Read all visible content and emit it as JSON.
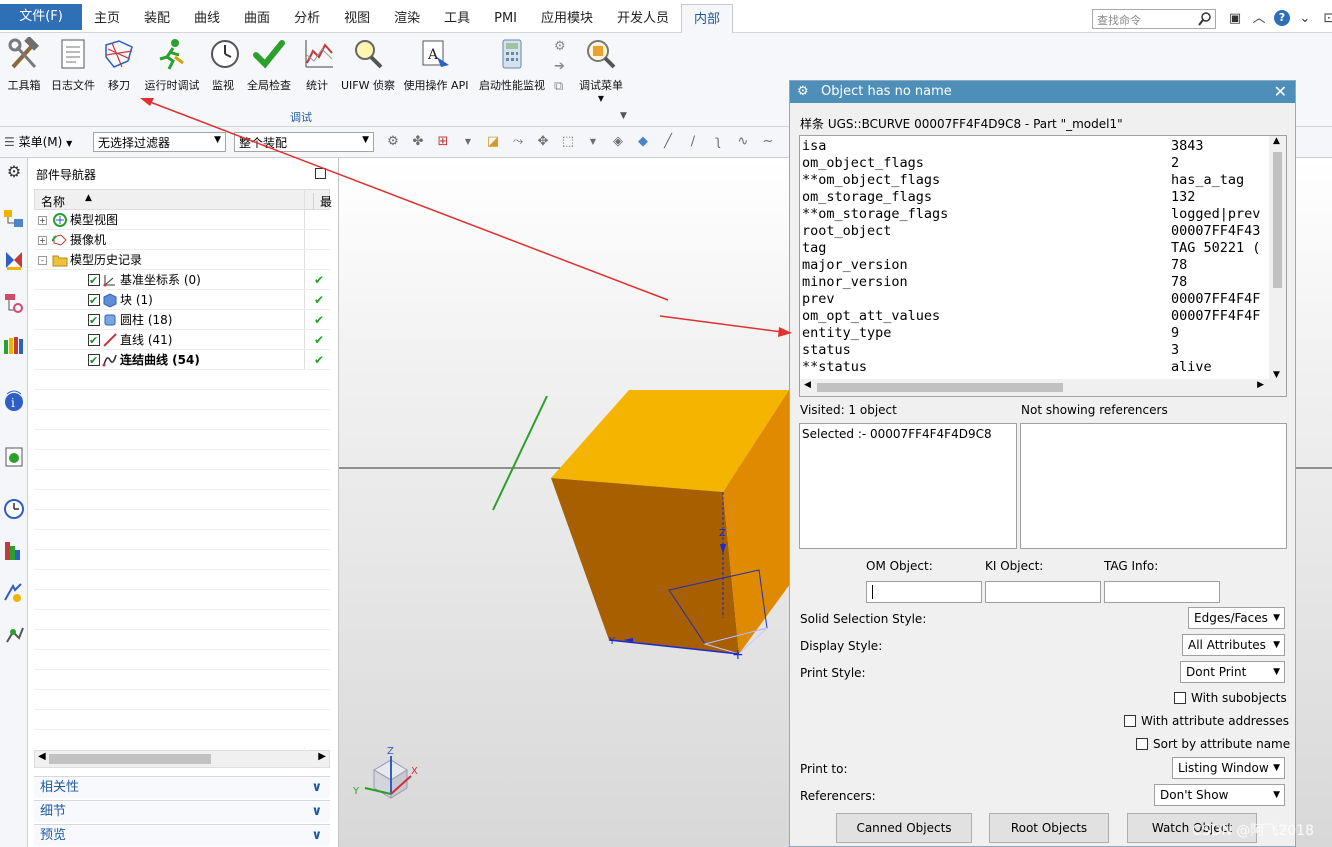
{
  "menubar": {
    "file_menu": "文件(F)",
    "tabs": [
      "主页",
      "装配",
      "曲线",
      "曲面",
      "分析",
      "视图",
      "渲染",
      "工具",
      "PMI",
      "应用模块",
      "开发人员",
      "内部"
    ],
    "active_tab": "内部",
    "search_placeholder": "查找命令"
  },
  "ribbon": {
    "buttons": [
      {
        "label": "工具箱",
        "icon": "hammer-wrench-icon"
      },
      {
        "label": "日志文件",
        "icon": "document-icon"
      },
      {
        "label": "移刀",
        "icon": "tool-path-icon"
      },
      {
        "label": "运行时调试",
        "icon": "runner-icon"
      },
      {
        "label": "监视",
        "icon": "clock-icon"
      },
      {
        "label": "全局检查",
        "icon": "checkmark-icon"
      },
      {
        "label": "统计",
        "icon": "chart-icon"
      },
      {
        "label": "UIFW 侦察",
        "icon": "magnifier-icon"
      },
      {
        "label": "使用操作 API",
        "icon": "api-icon"
      },
      {
        "label": "启动性能监视",
        "icon": "calculator-icon"
      },
      {
        "label": "调试菜单",
        "icon": "debug-menu-icon"
      }
    ],
    "group_label": "调试"
  },
  "selection_bar": {
    "menu_label": "菜单(M)",
    "filter": "无选择过滤器",
    "scope": "整个装配"
  },
  "navigator": {
    "title": "部件导航器",
    "col_name": "名称",
    "col_latest": "最",
    "rows": [
      {
        "label": "模型视图",
        "level": 0,
        "expander": "+",
        "checked": false,
        "ok": false,
        "icon": "model-views-icon"
      },
      {
        "label": "摄像机",
        "level": 0,
        "expander": "+",
        "checked": false,
        "ok": false,
        "icon": "camera-icon"
      },
      {
        "label": "模型历史记录",
        "level": 0,
        "expander": "-",
        "checked": false,
        "ok": false,
        "icon": "folder-icon"
      },
      {
        "label": "基准坐标系 (0)",
        "level": 1,
        "expander": "",
        "checked": true,
        "ok": true,
        "icon": "datum-csys-icon"
      },
      {
        "label": "块 (1)",
        "level": 1,
        "expander": "",
        "checked": true,
        "ok": true,
        "icon": "block-icon"
      },
      {
        "label": "圆柱 (18)",
        "level": 1,
        "expander": "",
        "checked": true,
        "ok": true,
        "icon": "cylinder-icon"
      },
      {
        "label": "直线 (41)",
        "level": 1,
        "expander": "",
        "checked": true,
        "ok": true,
        "icon": "line-icon"
      },
      {
        "label": "连结曲线 (54)",
        "level": 1,
        "expander": "",
        "checked": true,
        "ok": true,
        "icon": "joined-curve-icon",
        "bold": true
      }
    ],
    "ok_mark": "✔",
    "sections": [
      "相关性",
      "细节",
      "预览"
    ]
  },
  "triad": {
    "x": "X",
    "y": "Y",
    "z": "Z"
  },
  "model_labels": {
    "z": "Z",
    "y": "Y"
  },
  "dialog": {
    "title": "Object has no name",
    "info": "样条 UGS::BCURVE 00007FF4F4D9C8 - Part \"_model1\"",
    "attributes": [
      {
        "key": "isa",
        "value": "3843"
      },
      {
        "key": "om_object_flags",
        "value": "2"
      },
      {
        "key": "**om_object_flags",
        "value": "has_a_tag"
      },
      {
        "key": "om_storage_flags",
        "value": "132"
      },
      {
        "key": "**om_storage_flags",
        "value": "logged|prev"
      },
      {
        "key": "root_object",
        "value": "00007FF4F43"
      },
      {
        "key": "tag",
        "value": "TAG 50221 ("
      },
      {
        "key": "major_version",
        "value": "78"
      },
      {
        "key": "minor_version",
        "value": "78"
      },
      {
        "key": "prev",
        "value": "00007FF4F4F"
      },
      {
        "key": "om_opt_att_values",
        "value": "00007FF4F4F"
      },
      {
        "key": "entity_type",
        "value": "9"
      },
      {
        "key": "status",
        "value": "3"
      },
      {
        "key": "**status",
        "value": "alive"
      }
    ],
    "visited": "Visited: 1 object",
    "not_showing": "Not showing referencers",
    "selected": "Selected :- 00007FF4F4F4D9C8",
    "om_object_label": "OM Object:",
    "ki_object_label": "KI Object:",
    "tag_info_label": "TAG Info:",
    "solid_style_label": "Solid Selection Style:",
    "solid_style_value": "Edges/Faces",
    "display_style_label": "Display Style:",
    "display_style_value": "All Attributes",
    "print_style_label": "Print Style:",
    "print_style_value": "Dont Print",
    "with_subobjects": "With subobjects",
    "with_attr_addresses": "With attribute addresses",
    "sort_by_attr": "Sort by attribute name",
    "print_to_label": "Print to:",
    "print_to_value": "Listing Window",
    "referencers_label": "Referencers:",
    "referencers_value": "Don't Show",
    "buttons": [
      "Canned Objects",
      "Root Objects",
      "Watch Object"
    ]
  },
  "watermark": "CSDN @阿飞2018",
  "colors": {
    "file_menu_bg": "#2f6fb6",
    "dialog_title_bg": "#4d8fb8",
    "cube_top": "#f4b400",
    "cube_front": "#a85f00",
    "cube_side": "#df8a00",
    "arrow_red": "#e03030"
  }
}
